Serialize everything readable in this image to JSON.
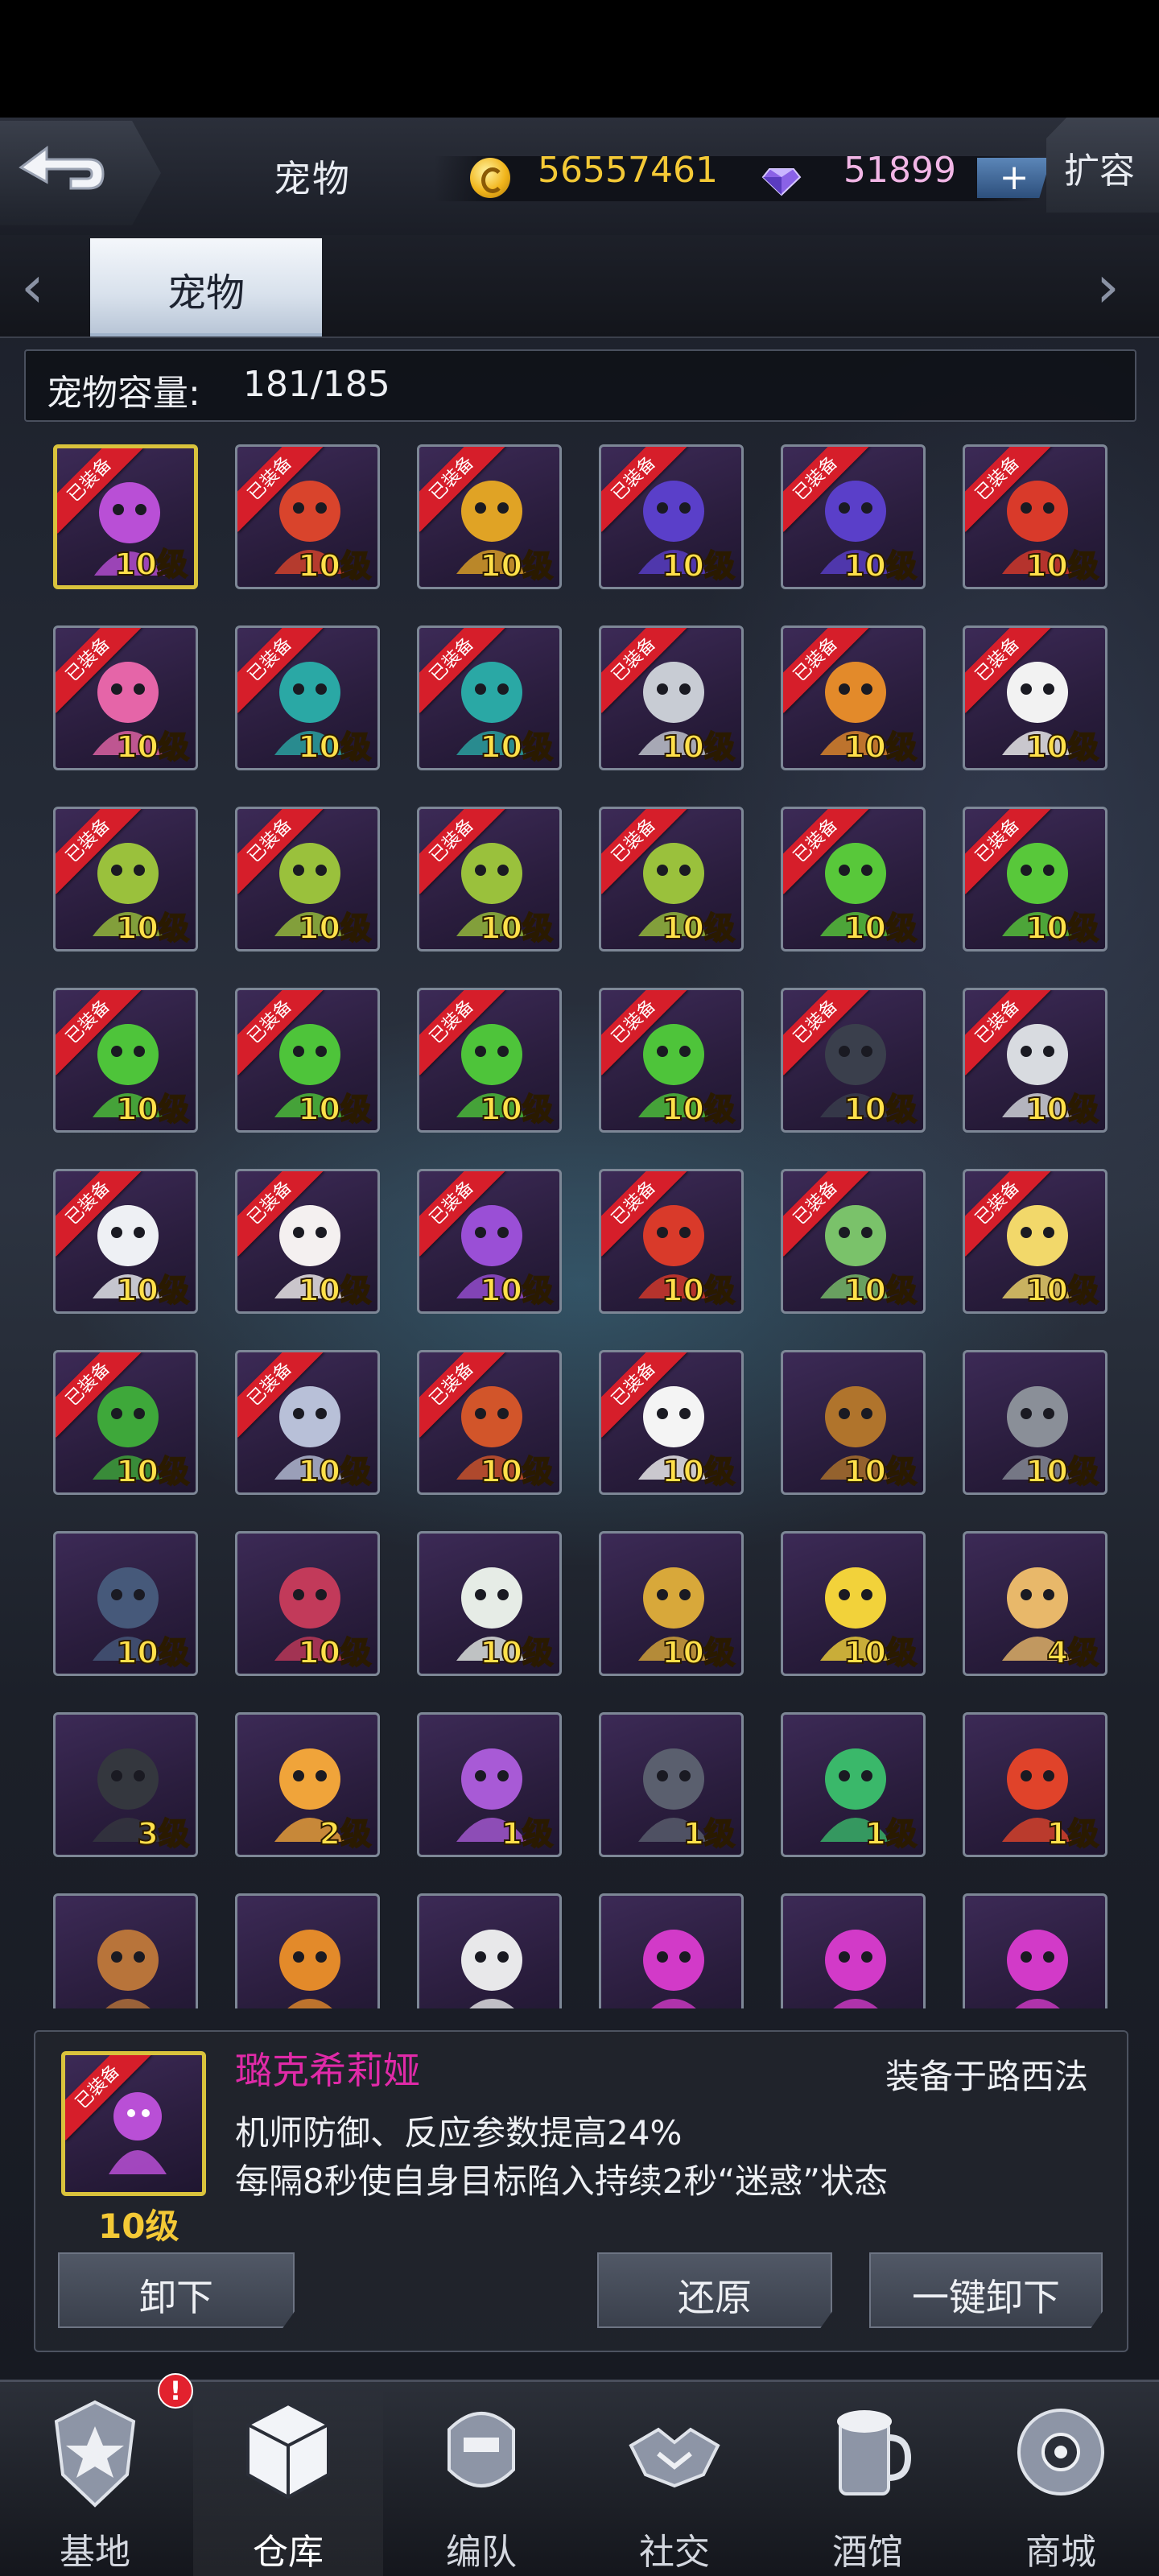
{
  "header": {
    "title": "宠物",
    "gold": "56557461",
    "diamonds": "51899",
    "add_label": "+",
    "expand_label": "扩容"
  },
  "tabs": [
    {
      "label": "宠物",
      "active": true
    }
  ],
  "capacity": {
    "label": "宠物容量:",
    "value": "181/185"
  },
  "equipped_tag": "已装备",
  "pets": [
    {
      "level": "10级",
      "equipped": true,
      "color": "#b94fd6",
      "selected": true
    },
    {
      "level": "10级",
      "equipped": true,
      "color": "#d9442c"
    },
    {
      "level": "10级",
      "equipped": true,
      "color": "#e0a325"
    },
    {
      "level": "10级",
      "equipped": true,
      "color": "#5a3fc9"
    },
    {
      "level": "10级",
      "equipped": true,
      "color": "#5a3fc9"
    },
    {
      "level": "10级",
      "equipped": true,
      "color": "#d93a2a"
    },
    {
      "level": "10级",
      "equipped": true,
      "color": "#e565a8"
    },
    {
      "level": "10级",
      "equipped": true,
      "color": "#2aa8a5"
    },
    {
      "level": "10级",
      "equipped": true,
      "color": "#2aa8a5"
    },
    {
      "level": "10级",
      "equipped": true,
      "color": "#c8ccd4"
    },
    {
      "level": "10级",
      "equipped": true,
      "color": "#e38a2a"
    },
    {
      "level": "10级",
      "equipped": true,
      "color": "#f2f2f2"
    },
    {
      "level": "10级",
      "equipped": true,
      "color": "#9ac13c"
    },
    {
      "level": "10级",
      "equipped": true,
      "color": "#9ac13c"
    },
    {
      "level": "10级",
      "equipped": true,
      "color": "#9ac13c"
    },
    {
      "level": "10级",
      "equipped": true,
      "color": "#9ac13c"
    },
    {
      "level": "10级",
      "equipped": true,
      "color": "#58c83a"
    },
    {
      "level": "10级",
      "equipped": true,
      "color": "#58c83a"
    },
    {
      "level": "10级",
      "equipped": true,
      "color": "#4ec43a"
    },
    {
      "level": "10级",
      "equipped": true,
      "color": "#4ec43a"
    },
    {
      "level": "10级",
      "equipped": true,
      "color": "#4ec43a"
    },
    {
      "level": "10级",
      "equipped": true,
      "color": "#4ec43a"
    },
    {
      "level": "10级",
      "equipped": true,
      "color": "#3a3f4c"
    },
    {
      "level": "10级",
      "equipped": true,
      "color": "#d8dbe0"
    },
    {
      "level": "10级",
      "equipped": true,
      "color": "#eef0f4"
    },
    {
      "level": "10级",
      "equipped": true,
      "color": "#f4f0f0"
    },
    {
      "level": "10级",
      "equipped": true,
      "color": "#9a4fd6"
    },
    {
      "level": "10级",
      "equipped": true,
      "color": "#d93a2a"
    },
    {
      "level": "10级",
      "equipped": true,
      "color": "#7ac26a"
    },
    {
      "level": "10级",
      "equipped": true,
      "color": "#f2d86a"
    },
    {
      "level": "10级",
      "equipped": true,
      "color": "#3ea83a"
    },
    {
      "level": "10级",
      "equipped": true,
      "color": "#b8c0d8"
    },
    {
      "level": "10级",
      "equipped": true,
      "color": "#d2552a"
    },
    {
      "level": "10级",
      "equipped": true,
      "color": "#f4f4f4"
    },
    {
      "level": "10级",
      "equipped": false,
      "color": "#b0742c"
    },
    {
      "level": "10级",
      "equipped": false,
      "color": "#8a8f98"
    },
    {
      "level": "10级",
      "equipped": false,
      "color": "#46597a"
    },
    {
      "level": "10级",
      "equipped": false,
      "color": "#c23a5a"
    },
    {
      "level": "10级",
      "equipped": false,
      "color": "#e6ece6"
    },
    {
      "level": "10级",
      "equipped": false,
      "color": "#d8a83a"
    },
    {
      "level": "10级",
      "equipped": false,
      "color": "#f2d23a"
    },
    {
      "level": "4级",
      "equipped": false,
      "color": "#e8b86a"
    },
    {
      "level": "3级",
      "equipped": false,
      "color": "#34373e"
    },
    {
      "level": "2级",
      "equipped": false,
      "color": "#f0a43a"
    },
    {
      "level": "1级",
      "equipped": false,
      "color": "#a85ad6"
    },
    {
      "level": "1级",
      "equipped": false,
      "color": "#5a5f6e"
    },
    {
      "level": "1级",
      "equipped": false,
      "color": "#3ab86a"
    },
    {
      "level": "1级",
      "equipped": false,
      "color": "#e0432a"
    },
    {
      "level": "",
      "equipped": false,
      "color": "#b8743a"
    },
    {
      "level": "",
      "equipped": false,
      "color": "#e38a2a"
    },
    {
      "level": "",
      "equipped": false,
      "color": "#e8e8ea"
    },
    {
      "level": "",
      "equipped": false,
      "color": "#d23ac8"
    },
    {
      "level": "",
      "equipped": false,
      "color": "#d23ac8"
    },
    {
      "level": "",
      "equipped": false,
      "color": "#d23ac8"
    }
  ],
  "detail": {
    "name": "璐克希莉娅",
    "equipped_on": "装备于路西法",
    "level": "10级",
    "effect_1": "机师防御、反应参数提高24%",
    "effect_2": "每隔8秒使自身目标陷入持续2秒“迷惑”状态",
    "btn_unequip": "卸下",
    "btn_restore": "还原",
    "btn_unequip_all": "一键卸下"
  },
  "nav": [
    {
      "label": "基地",
      "icon": "base-icon",
      "badge": "!"
    },
    {
      "label": "仓库",
      "icon": "warehouse-icon",
      "active": true
    },
    {
      "label": "编队",
      "icon": "formation-icon"
    },
    {
      "label": "社交",
      "icon": "social-icon"
    },
    {
      "label": "酒馆",
      "icon": "tavern-icon"
    },
    {
      "label": "商城",
      "icon": "shop-icon"
    }
  ]
}
